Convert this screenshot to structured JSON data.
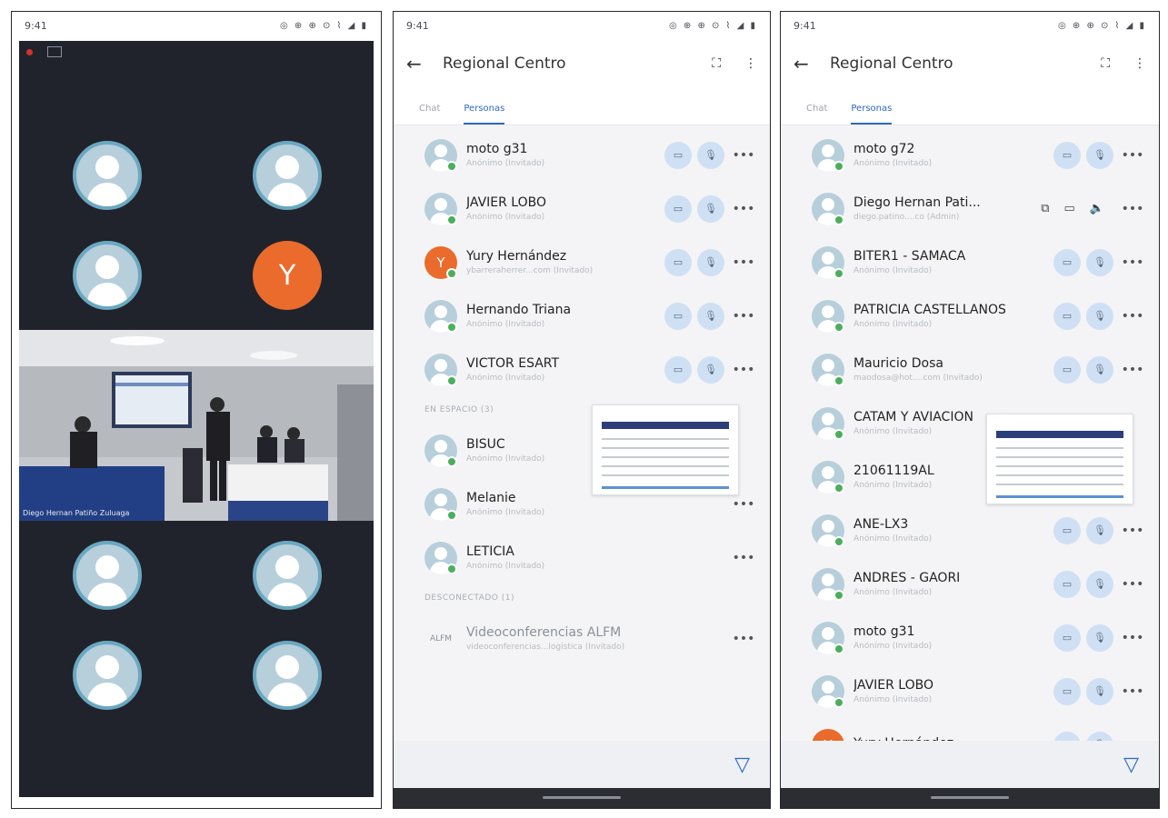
{
  "panel1": {
    "status": {
      "time": "9:41",
      "icons": "◎ ⊕ ⊕ ⊙ ⌇ ◢ ▮"
    },
    "tile_names": [
      "",
      "",
      "",
      "",
      "",
      "",
      "",
      ""
    ],
    "room_video_name": "Diego Hernan Patiño Zuluaga"
  },
  "panel2": {
    "status": {
      "time": "9:41",
      "icons": "◎ ⊕ ⊕ ⊙ ⌇ ◢ ▮"
    },
    "appbar": {
      "back": "←",
      "title": "Regional Centro",
      "expand": "⛶",
      "menu": "⋮"
    },
    "tabs": [
      {
        "label": "Chat"
      },
      {
        "label": "Personas"
      }
    ],
    "participants": [
      {
        "name": "moto g31",
        "sub": "Anónimo (Invitado)"
      },
      {
        "name": "JAVIER LOBO",
        "sub": "Anónimo (Invitado)"
      },
      {
        "name": "Yury Hernández",
        "sub": "ybarreraherrer...com (Invitado)",
        "initial": "Y"
      },
      {
        "name": "Hernando Triana",
        "sub": "Anónimo (Invitado)"
      },
      {
        "name": "VICTOR ESART",
        "sub": "Anónimo (Invitado)"
      }
    ],
    "section_space": "EN ESPACIO (3)",
    "space": [
      {
        "name": "BISUC",
        "sub": "Anónimo (Invitado)"
      },
      {
        "name": "Melanie",
        "sub": "Anónimo (Invitado)"
      },
      {
        "name": "LETICIA",
        "sub": "Anónimo (Invitado)"
      }
    ],
    "section_disconnected": "DESCONECTADO (1)",
    "disconnected": [
      {
        "name": "Videoconferencias ALFM",
        "sub": "videoconferencias...logistica (Invitado)",
        "logo": "ALFM"
      }
    ],
    "filter_icon": "filter-icon"
  },
  "panel3": {
    "status": {
      "time": "9:41",
      "icons": "◎ ⊕ ⊕ ⊙ ⌇ ◢ ▮"
    },
    "appbar": {
      "back": "←",
      "title": "Regional Centro",
      "expand": "⛶",
      "menu": "⋮"
    },
    "tabs": [
      {
        "label": "Chat"
      },
      {
        "label": "Personas"
      }
    ],
    "participants": [
      {
        "name": "moto g72",
        "sub": "Anónimo (Invitado)"
      },
      {
        "name": "Diego Hernan Pati...",
        "sub": "diego.patino....co (Admin)"
      },
      {
        "name": "BITER1 - SAMACA",
        "sub": "Anónimo (Invitado)"
      },
      {
        "name": "PATRICIA CASTELLANOS",
        "sub": "Anónimo (Invitado)"
      },
      {
        "name": "Mauricio Dosa",
        "sub": "maodosa@hot....com (Invitado)"
      },
      {
        "name": "CATAM Y AVIACION",
        "sub": "Anónimo (Invitado)"
      },
      {
        "name": "21061119AL",
        "sub": "Anónimo (Invitado)"
      },
      {
        "name": "ANE-LX3",
        "sub": "Anónimo (Invitado)"
      },
      {
        "name": "ANDRES - GAORI",
        "sub": "Anónimo (Invitado)"
      },
      {
        "name": "moto g31",
        "sub": "Anónimo (Invitado)"
      },
      {
        "name": "JAVIER LOBO",
        "sub": "Anónimo (Invitado)"
      },
      {
        "name": "Yury Hernández",
        "sub": "",
        "initial": "Y"
      }
    ],
    "filter_icon": "filter-icon"
  }
}
